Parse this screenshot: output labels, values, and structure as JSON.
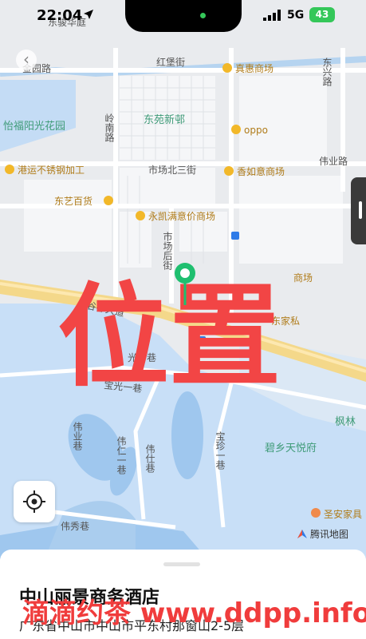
{
  "status_bar": {
    "time": "22:04",
    "network": "5G",
    "battery": "43"
  },
  "map": {
    "labels": {
      "tl_road": "东骏华庭",
      "jinyuan": "金园路",
      "honglu": "红堡街",
      "zhenhui": "真惠商场",
      "dongxing": "东兴路",
      "yifu": "怡福阳光花园",
      "lingnan": "岭南路",
      "dongyuan": "东苑新邨",
      "oppo": "oppo",
      "weiye": "伟业路",
      "gangyun": "港运不锈钢加工",
      "shichang3": "市场北三街",
      "xiangru": "香如意商场",
      "dongyi": "东艺百货",
      "yongkai": "永凯满意价商场",
      "shichanghou": "市场后街",
      "shangchang": "商场",
      "gudou": "谷都大道",
      "dongjia": "东家私",
      "guangyixiang": "光一巷",
      "baoguangyi": "宝光一巷",
      "fenglin": "枫林",
      "bixiang": "碧乡天悦府",
      "weiyexiang": "伟业巷",
      "weiren": "伟仁一巷",
      "weishi": "伟仕巷",
      "baozhen": "宝珍一巷",
      "weixiu": "伟秀巷",
      "shengan": "圣安家具"
    },
    "stamp_text": "位置",
    "provider": "腾讯地图"
  },
  "sheet": {
    "hotel_name": "中山丽景商务酒店",
    "address": "广东省中山市中山市平东村那窗山2-5层"
  },
  "watermark": "滴滴约茶 www.ddpp.info",
  "colors": {
    "pin": "#1fbf6f",
    "stamp": "#f24545",
    "water": "#c4dcf5",
    "land": "#e9ebee",
    "road": "#ffffff"
  }
}
